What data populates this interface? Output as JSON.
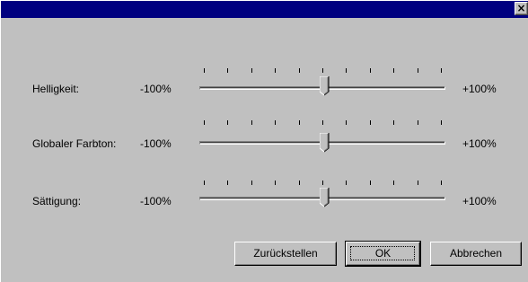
{
  "window": {
    "title": "",
    "close_glyph": "×"
  },
  "sliders": [
    {
      "label": "Helligkeit:",
      "min_label": "-100%",
      "max_label": "+100%",
      "value_percent": 0
    },
    {
      "label": "Globaler Farbton:",
      "min_label": "-100%",
      "max_label": "+100%",
      "value_percent": 0
    },
    {
      "label": "Sättigung:",
      "min_label": "-100%",
      "max_label": "+100%",
      "value_percent": 0
    }
  ],
  "buttons": {
    "reset_label": "Zurückstellen",
    "ok_label": "OK",
    "cancel_label": "Abbrechen"
  },
  "colors": {
    "title_bar": "#000080",
    "face": "#c0c0c0"
  }
}
